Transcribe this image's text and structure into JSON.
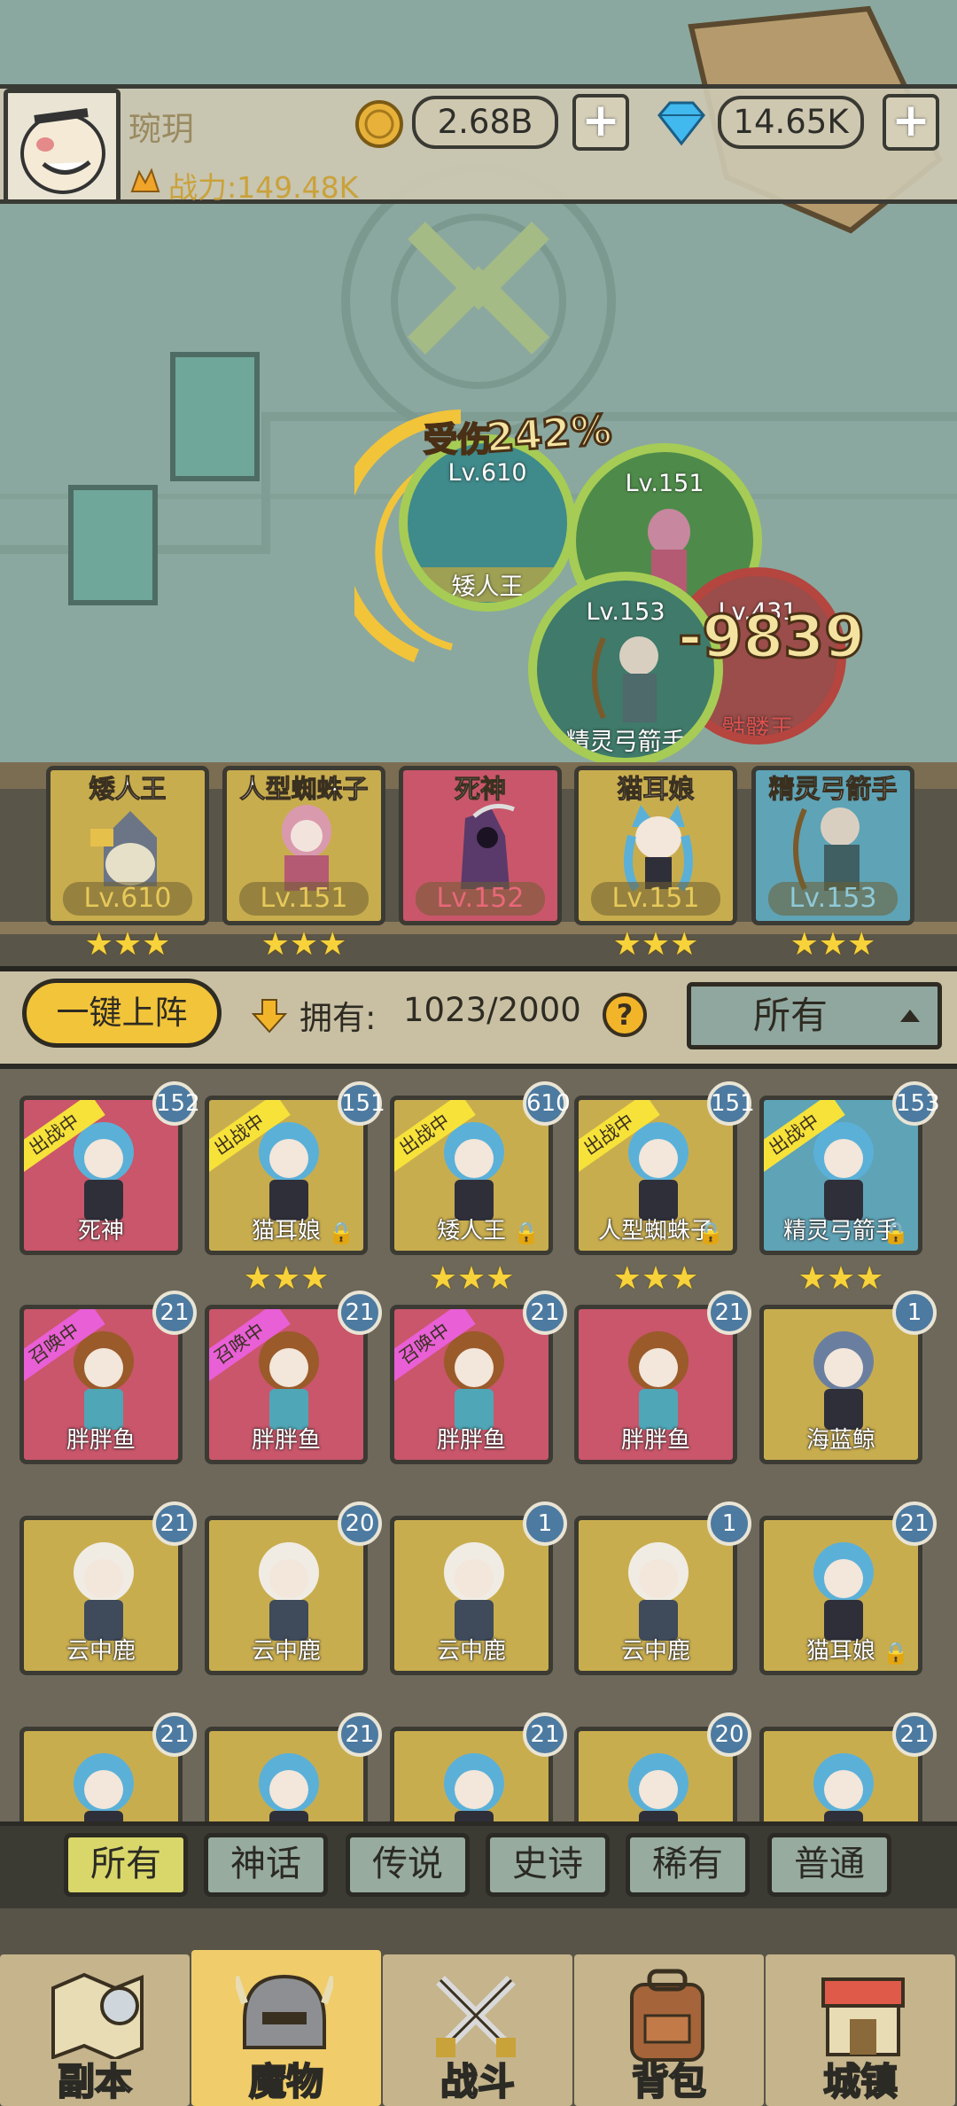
{
  "header": {
    "player_name": "琬玥",
    "power_text": "战力:149.48K",
    "gold": "2.68B",
    "diamonds": "14.65K",
    "plus": "+"
  },
  "battle": {
    "circles": [
      {
        "level": "Lv.610",
        "name": "矮人王"
      },
      {
        "level": "Lv.151",
        "name": ""
      },
      {
        "level": "Lv.153",
        "name": "精灵弓箭手"
      },
      {
        "level": "Lv.431",
        "name": "骷髅王"
      }
    ],
    "buff_text": "受伤",
    "buff_value": "242%",
    "damage_text": "-9839"
  },
  "team": [
    {
      "name": "矮人王",
      "level": "Lv.610",
      "stars": "★★★"
    },
    {
      "name": "人型蜘蛛子",
      "level": "Lv.151",
      "stars": "★★★"
    },
    {
      "name": "死神",
      "level": "Lv.152",
      "stars": ""
    },
    {
      "name": "猫耳娘",
      "level": "Lv.151",
      "stars": "★★★"
    },
    {
      "name": "精灵弓箭手",
      "level": "Lv.153",
      "stars": "★★★"
    }
  ],
  "controls": {
    "deploy_button": "一键上阵",
    "owned_label": "拥有:",
    "owned_value": "1023/2000",
    "help": "?",
    "filter_selected": "所有"
  },
  "grid": [
    {
      "name": "死神",
      "level": "152",
      "tag": "出战中",
      "stars": "",
      "locked": false
    },
    {
      "name": "猫耳娘",
      "level": "151",
      "tag": "出战中",
      "stars": "★★★",
      "locked": true
    },
    {
      "name": "矮人王",
      "level": "610",
      "tag": "出战中",
      "stars": "★★★",
      "locked": true
    },
    {
      "name": "人型蜘蛛子",
      "level": "151",
      "tag": "出战中",
      "stars": "★★★",
      "locked": true
    },
    {
      "name": "精灵弓箭手",
      "level": "153",
      "tag": "出战中",
      "stars": "★★★",
      "locked": true
    },
    {
      "name": "胖胖鱼",
      "level": "21",
      "tag": "召唤中",
      "stars": "",
      "locked": false
    },
    {
      "name": "胖胖鱼",
      "level": "21",
      "tag": "召唤中",
      "stars": "",
      "locked": false
    },
    {
      "name": "胖胖鱼",
      "level": "21",
      "tag": "召唤中",
      "stars": "",
      "locked": false
    },
    {
      "name": "胖胖鱼",
      "level": "21",
      "tag": "",
      "stars": "",
      "locked": false
    },
    {
      "name": "海蓝鲸",
      "level": "1",
      "tag": "",
      "stars": "",
      "locked": false
    },
    {
      "name": "云中鹿",
      "level": "21",
      "tag": "",
      "stars": "",
      "locked": false
    },
    {
      "name": "云中鹿",
      "level": "20",
      "tag": "",
      "stars": "",
      "locked": false
    },
    {
      "name": "云中鹿",
      "level": "1",
      "tag": "",
      "stars": "",
      "locked": false
    },
    {
      "name": "云中鹿",
      "level": "1",
      "tag": "",
      "stars": "",
      "locked": false
    },
    {
      "name": "猫耳娘",
      "level": "21",
      "tag": "",
      "stars": "",
      "locked": true
    },
    {
      "name": "",
      "level": "21",
      "tag": "",
      "stars": "",
      "locked": false
    },
    {
      "name": "",
      "level": "21",
      "tag": "",
      "stars": "",
      "locked": false
    },
    {
      "name": "",
      "level": "21",
      "tag": "",
      "stars": "",
      "locked": false
    },
    {
      "name": "",
      "level": "20",
      "tag": "",
      "stars": "",
      "locked": false
    },
    {
      "name": "",
      "level": "21",
      "tag": "",
      "stars": "",
      "locked": false
    }
  ],
  "rarity_tabs": [
    "所有",
    "神话",
    "传说",
    "史诗",
    "稀有",
    "普通"
  ],
  "bottom_nav": [
    "副本",
    "魔物",
    "战斗",
    "背包",
    "城镇"
  ],
  "lock_glyph": "🔒",
  "colors": {
    "card_red": "#c9566a",
    "card_yellow": "#c8ad4f",
    "card_blue": "#5fa3b6",
    "ribbon_active": "#f7e23a",
    "ribbon_summon": "#e85fd6"
  }
}
